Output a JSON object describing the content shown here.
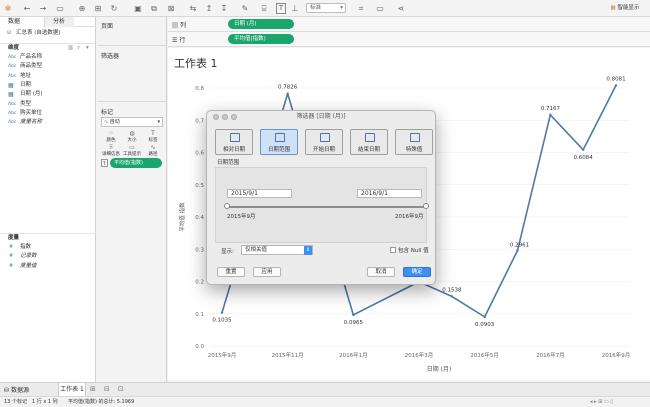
{
  "toolbar": {
    "show_me_label": "智能显示",
    "standard_label": "标准"
  },
  "left_panel": {
    "tab_data": "数据",
    "tab_analytics": "分析",
    "datasource": "汇总表 (自选数据)",
    "dimensions_header": "维度",
    "dimensions": [
      {
        "type": "Abc",
        "label": "产品名称"
      },
      {
        "type": "Abc",
        "label": "商品类型"
      },
      {
        "type": "Abc",
        "label": "地址"
      },
      {
        "type": "date",
        "label": "日期"
      },
      {
        "type": "date",
        "label": "日期 (月)"
      },
      {
        "type": "Abc",
        "label": "类型"
      },
      {
        "type": "Abc",
        "label": "购买单位"
      },
      {
        "type": "Abc",
        "label": "度量名称"
      }
    ],
    "measures_header": "度量",
    "measures": [
      {
        "label": "指数"
      },
      {
        "label": "记录数"
      },
      {
        "label": "度量值"
      }
    ]
  },
  "cards": {
    "pages": "页面",
    "filters": "筛选器",
    "marks": "标记",
    "marks_type": "自动",
    "mark_buttons": [
      "颜色",
      "大小",
      "标签",
      "详细信息",
      "工具提示",
      "路径"
    ],
    "marks_pill": "平均值(指数)"
  },
  "shelves": {
    "columns_label": "列",
    "rows_label": "行",
    "columns_pill": "日期 (月)",
    "rows_pill": "平均值(指数)"
  },
  "sheet": {
    "title": "工作表 1"
  },
  "chart_data": {
    "type": "line",
    "xlabel": "日期 (月)",
    "ylabel": "平均值 指数",
    "ylim": [
      0,
      0.8
    ],
    "y_ticks": [
      "0.0",
      "0.1",
      "0.2",
      "0.3",
      "0.4",
      "0.5",
      "0.6",
      "0.7",
      "0.8"
    ],
    "x_ticks": [
      "2015年9月",
      "2015年11月",
      "2016年1月",
      "2016年3月",
      "2016年5月",
      "2016年7月",
      "2016年9月"
    ],
    "points": [
      {
        "x": "2015-09",
        "y": 0.1035,
        "label": "0.1035"
      },
      {
        "x": "2015-11",
        "y": 0.7826,
        "label": "0.7826"
      },
      {
        "x": "2016-01",
        "y": 0.0965,
        "label": "0.0965"
      },
      {
        "x": "2016-03",
        "y": 0.1993,
        "label": "0.1993"
      },
      {
        "x": "2016-04",
        "y": 0.1538,
        "label": "0.1538"
      },
      {
        "x": "2016-05",
        "y": 0.0903,
        "label": "0.0903"
      },
      {
        "x": "2016-06",
        "y": 0.2961,
        "label": "0.2961"
      },
      {
        "x": "2016-07",
        "y": 0.7167,
        "label": "0.7167"
      },
      {
        "x": "2016-08",
        "y": 0.6084,
        "label": "0.6084"
      },
      {
        "x": "2016-09",
        "y": 0.8081,
        "label": "0.8081"
      }
    ],
    "line_color": "#4e79a7"
  },
  "dialog": {
    "title": "筛选器 [日期 (月)]",
    "modes": [
      "相对日期",
      "日期范围",
      "开始日期",
      "结束日期",
      "特殊值"
    ],
    "active_mode": "日期范围",
    "range_label": "日期范围",
    "start_value": "2015/9/1",
    "end_value": "2016/9/1",
    "slider_start": "2015年9月",
    "slider_end": "2016年9月",
    "show_label": "显示:",
    "show_value": "仅相关值",
    "include_null": "包含 Null 值",
    "buttons": {
      "reset": "重置",
      "apply": "应用",
      "cancel": "取消",
      "ok": "确定"
    }
  },
  "bottom": {
    "datasource_tab": "数据源",
    "sheet_tab": "工作表 1"
  },
  "status": {
    "marks": "13 个标记",
    "rows_cols": "1 行 x 1 列",
    "sum": "平均值(指数) 的总计: 5.1969"
  }
}
